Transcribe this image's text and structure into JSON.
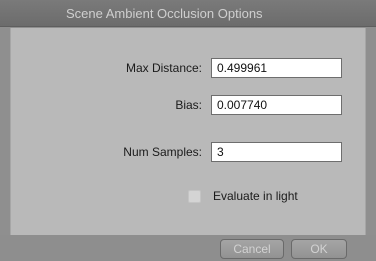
{
  "window": {
    "title": "Scene Ambient Occlusion Options"
  },
  "fields": [
    {
      "label": "Max Distance:",
      "value": "0.499961"
    },
    {
      "label": "Bias:",
      "value": "0.007740"
    },
    {
      "label": "Num Samples:",
      "value": "3"
    }
  ],
  "evaluate_in_light": {
    "label": "Evaluate in light",
    "checked": false
  },
  "buttons": {
    "cancel": "Cancel",
    "ok": "OK"
  },
  "colors": {
    "titlebar": "#6c6c6c",
    "panel": "#b9b9b9",
    "frame": "#8f8f8f"
  }
}
